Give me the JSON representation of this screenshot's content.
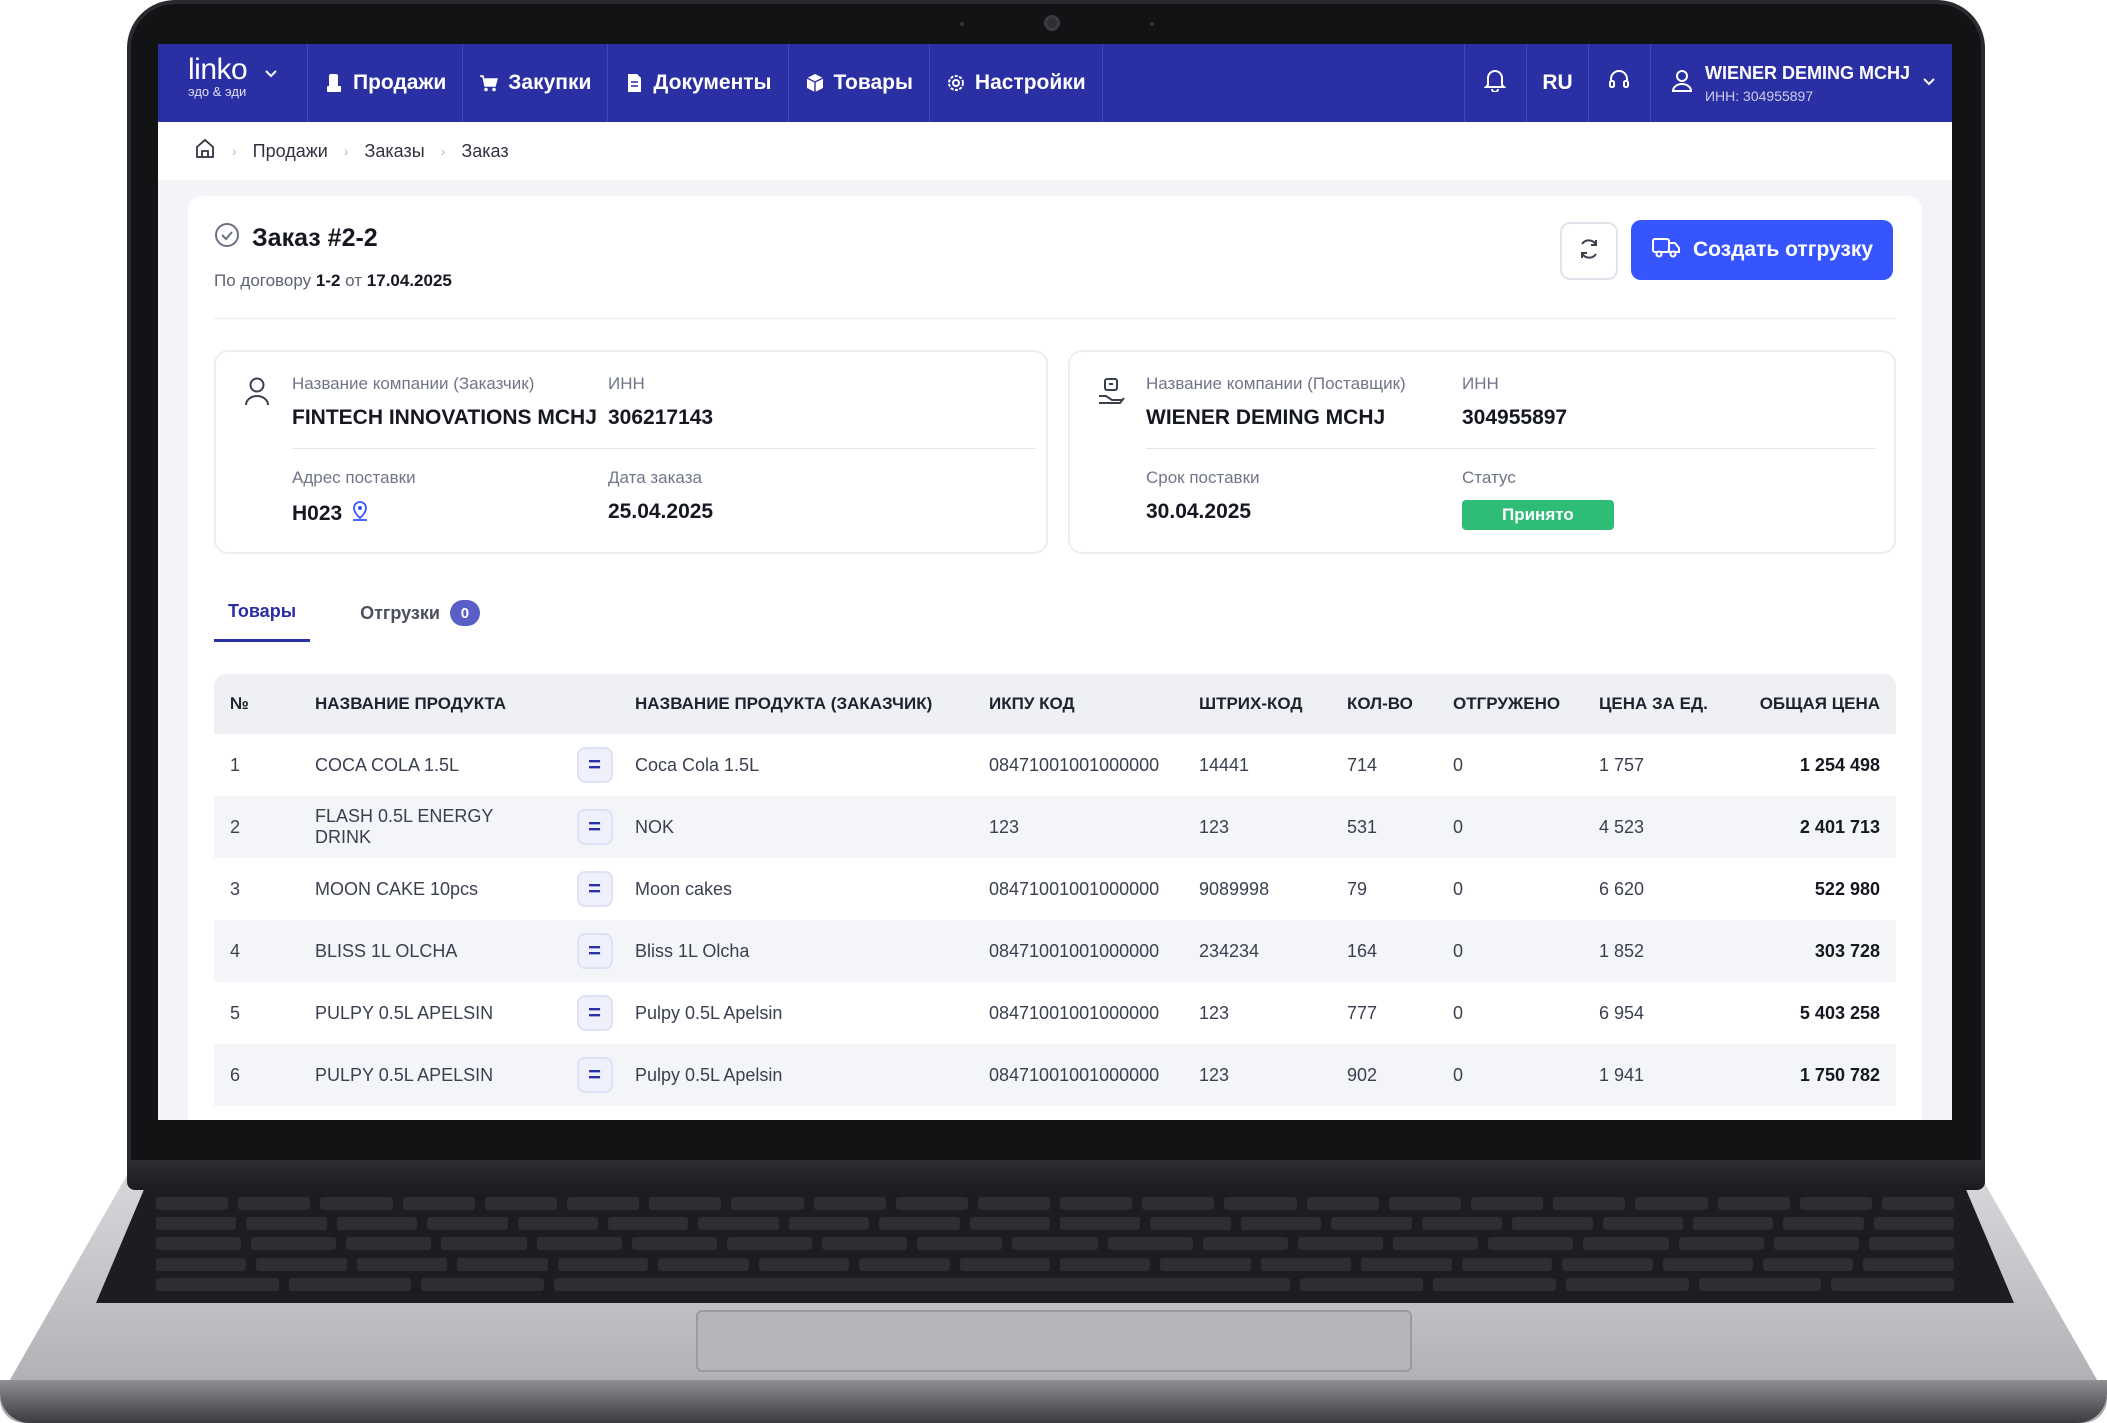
{
  "nav": {
    "brand": "linko",
    "brand_sub": "эдо & эди",
    "items": [
      {
        "label": "Продажи",
        "icon": "sales-icon"
      },
      {
        "label": "Закупки",
        "icon": "cart-icon"
      },
      {
        "label": "Документы",
        "icon": "documents-icon"
      },
      {
        "label": "Товары",
        "icon": "box-icon"
      },
      {
        "label": "Настройки",
        "icon": "gear-icon"
      }
    ],
    "lang": "RU",
    "user_name": "WIENER DEMING MCHJ",
    "user_inn": "ИНН: 304955897"
  },
  "breadcrumb": [
    "Продажи",
    "Заказы",
    "Заказ"
  ],
  "order": {
    "title": "Заказ #2-2",
    "contract_prefix": "По договору",
    "contract_no": "1-2",
    "contract_from": "от",
    "contract_date": "17.04.2025",
    "create_label": "Создать отгрузку"
  },
  "customer": {
    "name_label": "Название компании (Заказчик)",
    "name": "FINTECH INNOVATIONS MCHJ",
    "inn_label": "ИНН",
    "inn": "306217143",
    "address_label": "Адрес поставки",
    "address": "H023",
    "date_label": "Дата заказа",
    "date": "25.04.2025"
  },
  "supplier": {
    "name_label": "Название компании (Поставщик)",
    "name": "WIENER DEMING MCHJ",
    "inn_label": "ИНН",
    "inn": "304955897",
    "term_label": "Срок поставки",
    "term": "30.04.2025",
    "status_label": "Статус",
    "status": "Принято",
    "status_color": "#2ebd77"
  },
  "tabs": {
    "goods": "Товары",
    "shipments": "Отгрузки",
    "shipments_count": "0"
  },
  "table": {
    "headers": {
      "no": "№",
      "name": "НАЗВАНИЕ ПРОДУКТА",
      "cname": "НАЗВАНИЕ ПРОДУКТА (ЗАКАЗЧИК)",
      "ikpu": "ИКПУ КОД",
      "barcode": "ШТРИХ-КОД",
      "qty": "КОЛ-ВО",
      "shipped": "ОТГРУЖЕНО",
      "price": "ЦЕНА ЗА ЕД.",
      "total": "ОБЩАЯ ЦЕНА"
    },
    "rows": [
      {
        "no": "1",
        "name": "COCA COLA 1.5L",
        "cname": "Coca Cola 1.5L",
        "ikpu": "08471001001000000",
        "barcode": "14441",
        "qty": "714",
        "shipped": "0",
        "price": "1 757",
        "total": "1 254 498"
      },
      {
        "no": "2",
        "name": "FLASH 0.5L ENERGY DRINK",
        "cname": "NOK",
        "ikpu": "123",
        "barcode": "123",
        "qty": "531",
        "shipped": "0",
        "price": "4 523",
        "total": "2 401 713"
      },
      {
        "no": "3",
        "name": "MOON CAKE 10pcs",
        "cname": "Moon cakes",
        "ikpu": "08471001001000000",
        "barcode": "9089998",
        "qty": "79",
        "shipped": "0",
        "price": "6 620",
        "total": "522 980"
      },
      {
        "no": "4",
        "name": "BLISS 1L OLCHA",
        "cname": "Bliss 1L Olcha",
        "ikpu": "08471001001000000",
        "barcode": "234234",
        "qty": "164",
        "shipped": "0",
        "price": "1 852",
        "total": "303 728"
      },
      {
        "no": "5",
        "name": "PULPY 0.5L APELSIN",
        "cname": "Pulpy 0.5L Apelsin",
        "ikpu": "08471001001000000",
        "barcode": "123",
        "qty": "777",
        "shipped": "0",
        "price": "6 954",
        "total": "5 403 258"
      },
      {
        "no": "6",
        "name": "PULPY 0.5L APELSIN",
        "cname": "Pulpy 0.5L Apelsin",
        "ikpu": "08471001001000000",
        "barcode": "123",
        "qty": "902",
        "shipped": "0",
        "price": "1 941",
        "total": "1 750 782"
      }
    ]
  },
  "colors": {
    "nav_bg": "#2a2fa3",
    "accent": "#3755ff",
    "status_green": "#2ebd77"
  }
}
